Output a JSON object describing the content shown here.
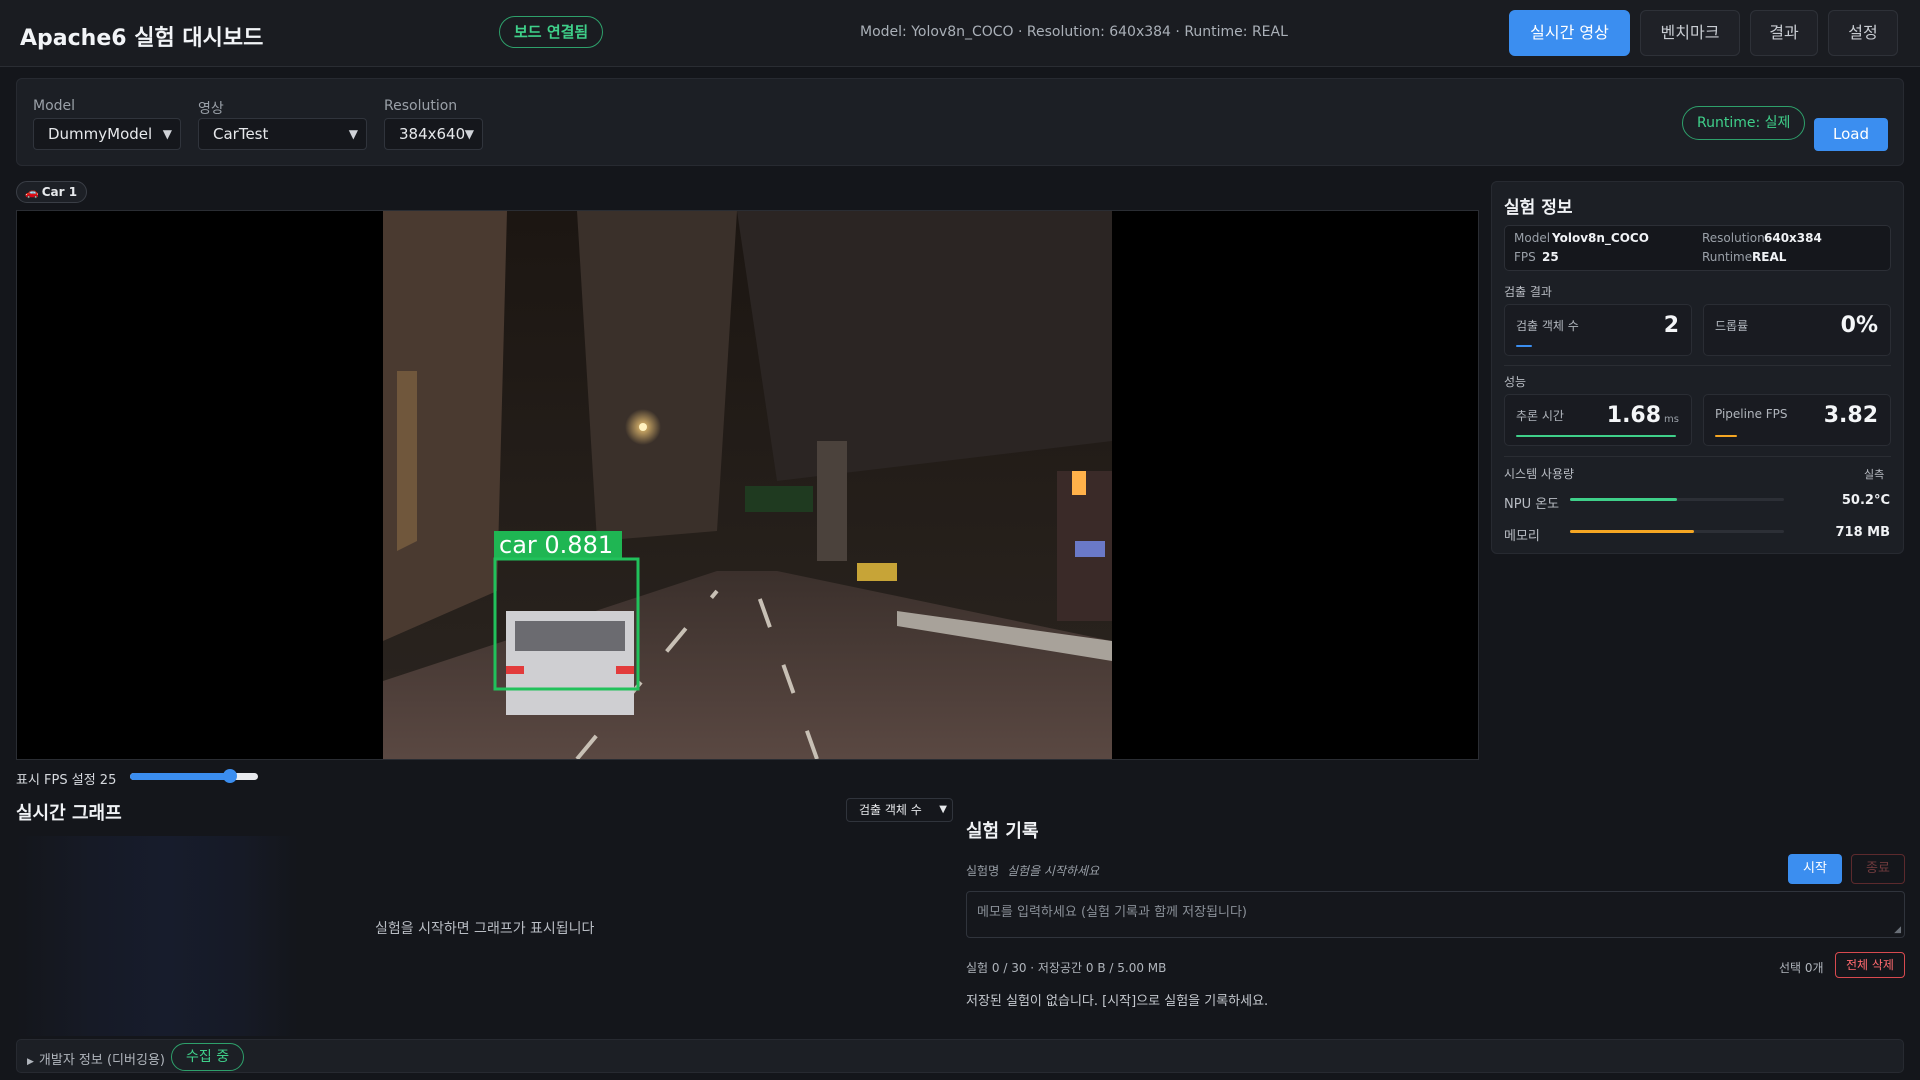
{
  "header": {
    "title": "Apache6 실험 대시보드",
    "board_status": "보드 연결됨",
    "meta": "Model: Yolov8n_COCO · Resolution: 640x384 · Runtime: REAL",
    "tabs": [
      {
        "label": "실시간 영상",
        "active": true
      },
      {
        "label": "벤치마크",
        "active": false
      },
      {
        "label": "결과",
        "active": false
      },
      {
        "label": "설정",
        "active": false
      }
    ]
  },
  "controls": {
    "model_label": "Model",
    "model_value": "DummyModel",
    "video_label": "영상",
    "video_value": "CarTest",
    "resolution_label": "Resolution",
    "resolution_value": "384x640",
    "runtime_pill": "Runtime: 실제",
    "load_label": "Load"
  },
  "camera": {
    "chip_label": "Car 1",
    "detection_label": "car 0.881",
    "fps_label": "표시 FPS 설정 25",
    "fps_slider_fraction": 0.78
  },
  "info": {
    "title": "실험 정보",
    "meta": {
      "model_k": "Model",
      "model_v": "Yolov8n_COCO",
      "resolution_k": "Resolution",
      "resolution_v": "640x384",
      "fps_k": "FPS",
      "fps_v": "25",
      "runtime_k": "Runtime",
      "runtime_v": "REAL"
    },
    "detect_section": "검출 결과",
    "detect_count_label": "검출 객체 수",
    "detect_count_value": "2",
    "drop_label": "드롭률",
    "drop_value": "0%",
    "perf_section": "성능",
    "infer_label": "추론 시간",
    "infer_value": "1.68",
    "infer_unit": "ms",
    "pipeline_label": "Pipeline FPS",
    "pipeline_value": "3.82",
    "system_section": "시스템 사용량",
    "system_mode": "실측",
    "npu_label": "NPU 온도",
    "npu_value": "50.2°C",
    "npu_fraction": 0.5,
    "mem_label": "메모리",
    "mem_value": "718 MB",
    "mem_fraction": 0.58
  },
  "graph": {
    "title": "실시간 그래프",
    "metric_select": "검출 객체 수",
    "empty_message": "실험을 시작하면 그래프가 표시됩니다"
  },
  "log": {
    "title": "실험 기록",
    "name_label": "실험명",
    "name_value": "실험을  시작하세요",
    "start_label": "시작",
    "stop_label": "종료",
    "memo_placeholder": "메모를 입력하세요 (실험 기록과 함께 저장됩니다)",
    "storage_info": "실험 0 / 30 · 저장공간 0 B / 5.00 MB",
    "selected_info": "선택 0개",
    "delete_all_label": "전체 삭제",
    "empty_message": "저장된 실험이 없습니다. [시작]으로 실험을 기록하세요."
  },
  "dev": {
    "label": "개발자 정보 (디버깅용)",
    "status_pill": "수집 중"
  },
  "colors": {
    "accent": "#3b8ef0",
    "success": "#3fd08a",
    "danger": "#ff6a6f",
    "warning": "#f5a623"
  }
}
